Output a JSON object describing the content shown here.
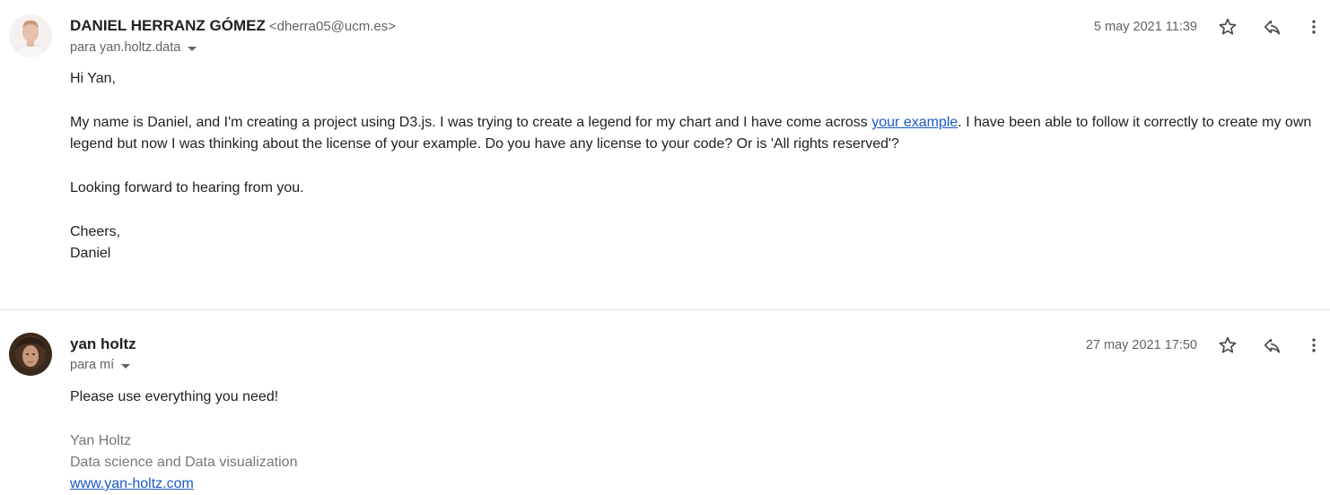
{
  "messages": [
    {
      "sender_name": "DANIEL HERRANZ GÓMEZ",
      "sender_email": "<dherra05@ucm.es>",
      "recipient": "para yan.holtz.data",
      "date": "5 may 2021 11:39",
      "body": {
        "greeting": "Hi Yan,",
        "para1_before": "My name is Daniel, and I'm creating a project using D3.js. I was trying to create a legend for my chart and I have come across ",
        "para1_link": "your example",
        "para1_after": ". I have been able to follow it correctly to create my own legend but now I was thinking about the license of your example. Do you have any license to your code? Or is 'All rights reserved'?",
        "para2": "Looking forward to hearing from you.",
        "closing": "Cheers,",
        "signature": "Daniel"
      }
    },
    {
      "sender_name": "yan holtz",
      "recipient": "para mí",
      "date": "27 may 2021 17:50",
      "body": {
        "text": "Please use everything you need!",
        "sig_name": "Yan Holtz",
        "sig_title": "Data science and Data visualization",
        "sig_link": "www.yan-holtz.com"
      }
    }
  ],
  "icons": {
    "star": "star-icon",
    "reply": "reply-icon",
    "more": "more-vert-icon"
  },
  "colors": {
    "link": "#1a59c5",
    "meta_text": "#5f6368",
    "signature_text": "#777777"
  }
}
